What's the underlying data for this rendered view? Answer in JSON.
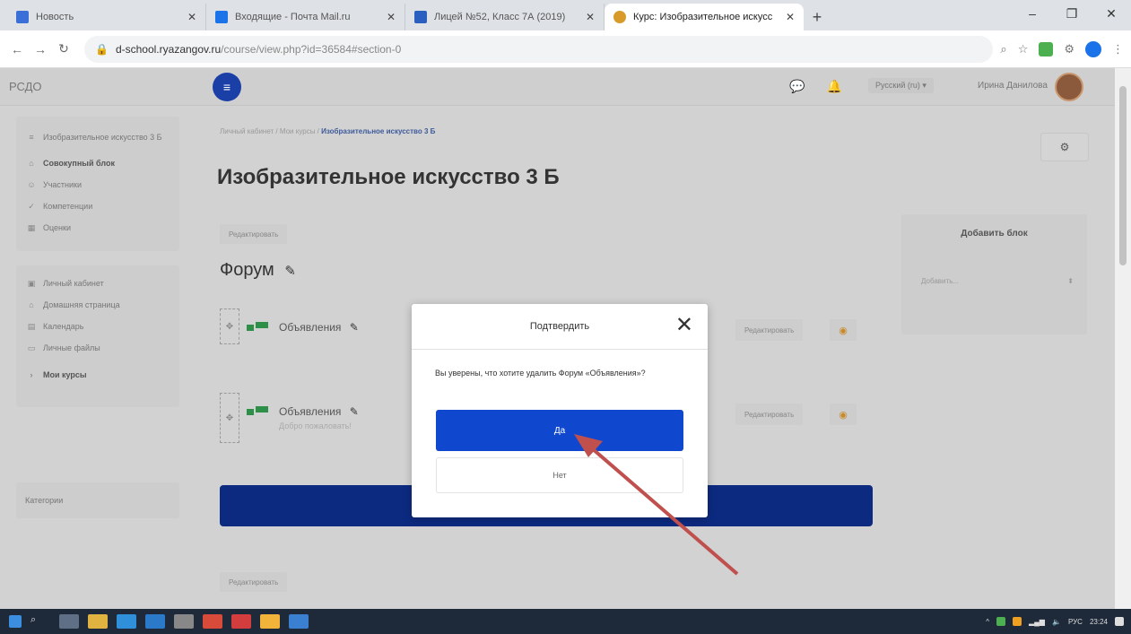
{
  "browser": {
    "tabs": [
      {
        "title": "Новость",
        "color": "#3a6fd8"
      },
      {
        "title": "Входящие - Почта Mail.ru",
        "color": "#1a73e8"
      },
      {
        "title": "Лицей №52, Класс 7А (2019)",
        "color": "#2b5fbf"
      },
      {
        "title": "Курс: Изобразительное искусс",
        "color": "#d89b2a"
      }
    ],
    "new_tab": "+",
    "url_host": "d-school.ryazangov.ru",
    "url_path": "/course/view.php?id=36584#section-0"
  },
  "header": {
    "brand": "РСДО",
    "language": "Русский (ru) ▾",
    "user_name": "Ирина Данилова"
  },
  "sidebar": {
    "course_items": [
      {
        "icon": "≡",
        "label": "Изобразительное искусство 3 Б",
        "bold": false
      },
      {
        "icon": "⌂",
        "label": "Совокупный блок",
        "bold": true
      },
      {
        "icon": "☺",
        "label": "Участники",
        "bold": false
      },
      {
        "icon": "✓",
        "label": "Компетенции",
        "bold": false
      },
      {
        "icon": "▦",
        "label": "Оценки",
        "bold": false
      }
    ],
    "site_items": [
      {
        "icon": "▣",
        "label": "Личный кабинет",
        "bold": false
      },
      {
        "icon": "⌂",
        "label": "Домашняя страница",
        "bold": false
      },
      {
        "icon": "▤",
        "label": "Календарь",
        "bold": false
      },
      {
        "icon": "▭",
        "label": "Личные файлы",
        "bold": false
      },
      {
        "icon": "›",
        "label": "Мои курсы",
        "bold": true
      }
    ],
    "categories": "Категории"
  },
  "main": {
    "breadcrumb": "Личный кабинет / Мои курсы /",
    "breadcrumb_current": "Изобразительное искусство 3 Б",
    "course_title": "Изобразительное искусство 3 Б",
    "edit_label": "Редактировать",
    "section_title": "Форум",
    "activities": [
      {
        "name": "Объявления",
        "desc": "",
        "edit": "Редактировать"
      },
      {
        "name": "Объявления",
        "desc": "Добро пожаловать!",
        "edit": "Редактировать"
      }
    ],
    "bottom_edit": "Редактировать"
  },
  "block": {
    "title": "Добавить блок",
    "select": "Добавить..."
  },
  "modal": {
    "title": "Подтвердить",
    "body": "Вы уверены, что хотите удалить Форум «Объявления»?",
    "yes": "Да",
    "no": "Нет"
  },
  "taskbar": {
    "lang": "РУС",
    "time": "23:24"
  },
  "colors": {
    "accent": "#0f47cf",
    "primary_dark": "#0c2a80",
    "arrow": "#c0504d"
  }
}
